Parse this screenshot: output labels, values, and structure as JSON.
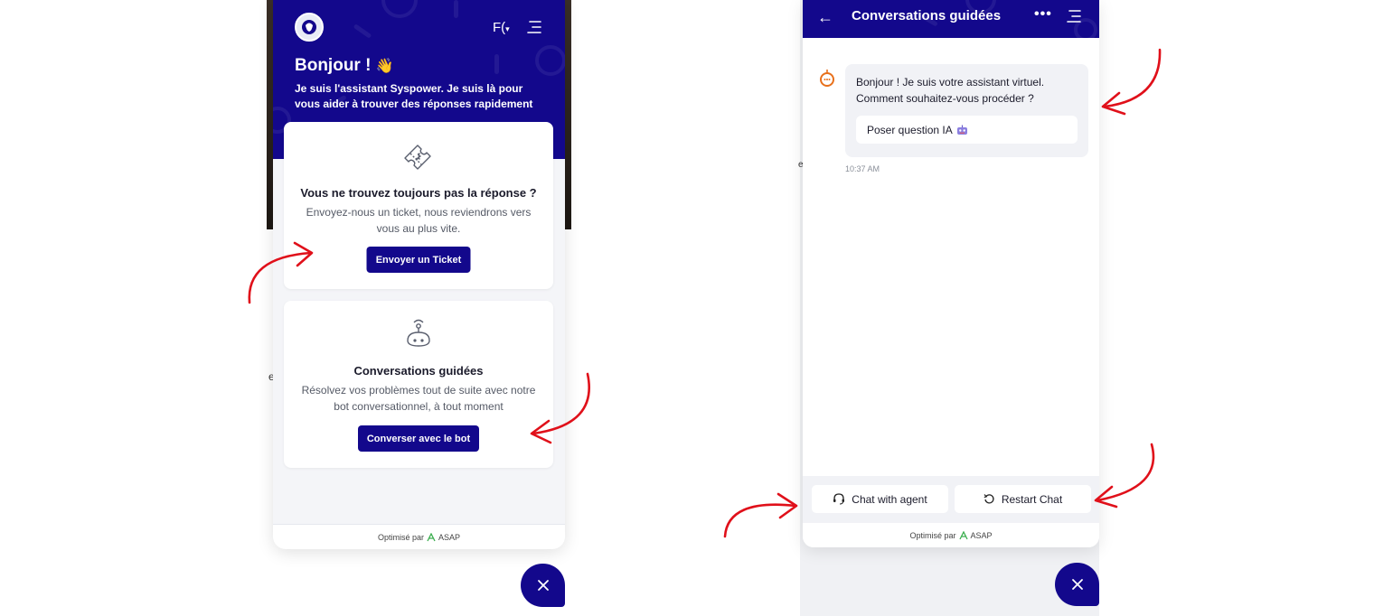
{
  "left_widget": {
    "lang_label": "F(",
    "greeting": "Bonjour !",
    "greeting_emoji": "👋",
    "subtitle": "Je suis l'assistant Syspower. Je suis là pour vous aider à trouver des réponses rapidement",
    "ticket_card": {
      "icon": "ticket-icon",
      "title": "Vous ne trouvez toujours pas la réponse ?",
      "description": "Envoyez-nous un ticket, nous reviendrons vers vous au plus vite.",
      "button_label": "Envoyer un Ticket"
    },
    "bot_card": {
      "icon": "robot-icon",
      "title": "Conversations guidées",
      "description": "Résolvez vos problèmes tout de suite avec notre bot conversationnel, à tout moment",
      "button_label": "Converser avec le bot"
    },
    "footer": {
      "prefix": "Optimisé par",
      "brand": "ASAP"
    },
    "stray_char": "e"
  },
  "right_widget": {
    "header": {
      "title": "Conversations guidées"
    },
    "bot_message": {
      "text": "Bonjour ! Je suis votre assistant virtuel. Comment souhaitez-vous procéder ?",
      "option_label": "Poser question IA",
      "time": "10:37 AM"
    },
    "actions": {
      "chat_agent_label": "Chat with agent",
      "restart_label": "Restart Chat"
    },
    "footer": {
      "prefix": "Optimisé par",
      "brand": "ASAP"
    },
    "stray_char": "e"
  },
  "colors": {
    "brand_navy": "#13088c",
    "annotation_red": "#e0101a",
    "panel_bg": "#f4f5f8"
  }
}
